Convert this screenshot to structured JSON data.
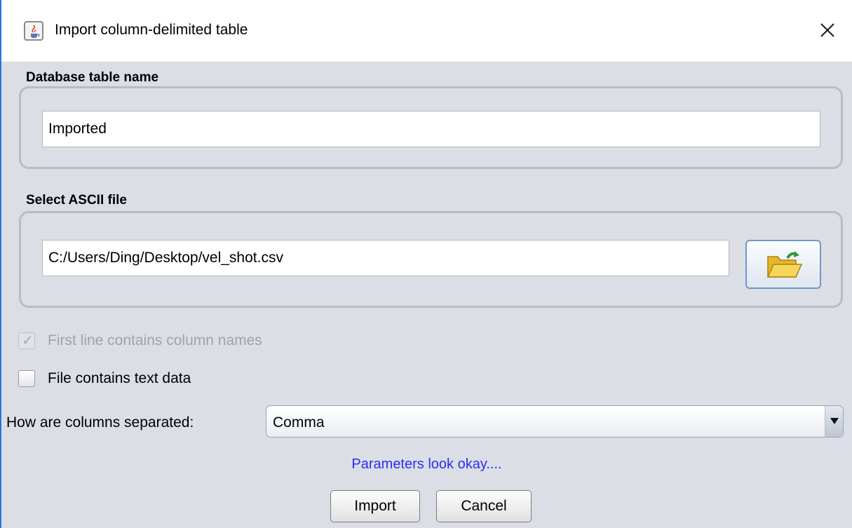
{
  "window": {
    "title": "Import column-delimited table"
  },
  "table_name_group": {
    "label": "Database table name",
    "value": "Imported"
  },
  "file_group": {
    "label": "Select ASCII file",
    "path": "C:/Users/Ding/Desktop/vel_shot.csv"
  },
  "options": {
    "first_line_label": "First line contains column names",
    "first_line_checked": true,
    "first_line_enabled": false,
    "text_data_label": "File contains text data",
    "text_data_checked": false
  },
  "separator": {
    "label": "How are columns separated:",
    "selected": "Comma"
  },
  "status": {
    "message": "Parameters look okay....",
    "color": "#2a2df4"
  },
  "buttons": {
    "import_label": "Import",
    "cancel_label": "Cancel"
  },
  "icons": {
    "app": "java-cup-icon",
    "close": "close-icon",
    "browse": "open-folder-icon",
    "dropdown": "triangle-down-icon"
  }
}
